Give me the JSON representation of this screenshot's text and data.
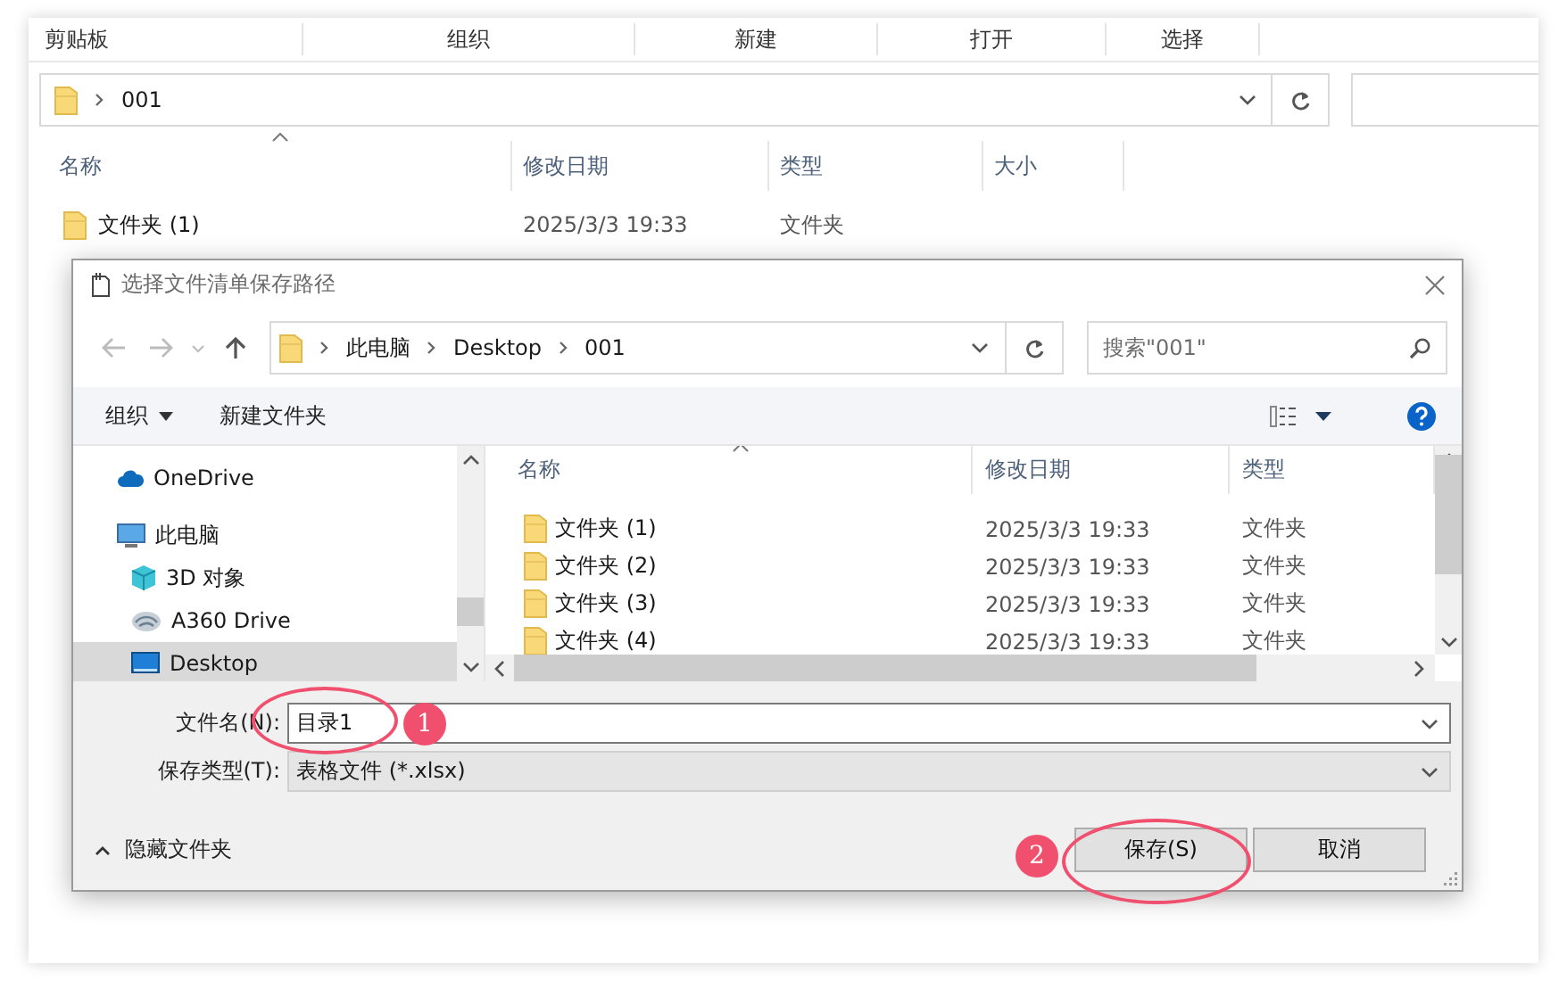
{
  "explorer": {
    "ribbon_groups": [
      "剪贴板",
      "组织",
      "新建",
      "打开",
      "选择"
    ],
    "address": {
      "path": [
        "001"
      ]
    },
    "columns": [
      "名称",
      "修改日期",
      "类型",
      "大小"
    ],
    "rows": [
      {
        "name": "文件夹 (1)",
        "modified": "2025/3/3 19:33",
        "type": "文件夹"
      }
    ]
  },
  "dialog": {
    "title": "选择文件清单保存路径",
    "address": {
      "path": [
        "此电脑",
        "Desktop",
        "001"
      ]
    },
    "search": {
      "placeholder": "搜索\"001\""
    },
    "toolbar": {
      "organize": "组织",
      "new_folder": "新建文件夹"
    },
    "nav_pane": {
      "items": [
        {
          "label": "OneDrive",
          "kind": "cloud",
          "selected": false
        },
        {
          "label": "此电脑",
          "kind": "computer",
          "selected": false,
          "children": [
            {
              "label": "3D 对象",
              "kind": "cube",
              "selected": false
            },
            {
              "label": "A360 Drive",
              "kind": "drive",
              "selected": false
            },
            {
              "label": "Desktop",
              "kind": "desktop",
              "selected": true
            }
          ]
        }
      ]
    },
    "file_list": {
      "columns": [
        "名称",
        "修改日期",
        "类型"
      ],
      "rows": [
        {
          "name": "文件夹 (1)",
          "modified": "2025/3/3 19:33",
          "type": "文件夹"
        },
        {
          "name": "文件夹 (2)",
          "modified": "2025/3/3 19:33",
          "type": "文件夹"
        },
        {
          "name": "文件夹 (3)",
          "modified": "2025/3/3 19:33",
          "type": "文件夹"
        },
        {
          "name": "文件夹 (4)",
          "modified": "2025/3/3 19:33",
          "type": "文件夹"
        }
      ]
    },
    "file_name": {
      "label": "文件名(N):",
      "value": "目录1"
    },
    "file_type": {
      "label": "保存类型(T):",
      "value": "表格文件 (*.xlsx)"
    },
    "hide_folders": "隐藏文件夹",
    "buttons": [
      "保存(S)",
      "取消"
    ],
    "annotations": [
      {
        "number": "1"
      },
      {
        "number": "2"
      }
    ]
  }
}
